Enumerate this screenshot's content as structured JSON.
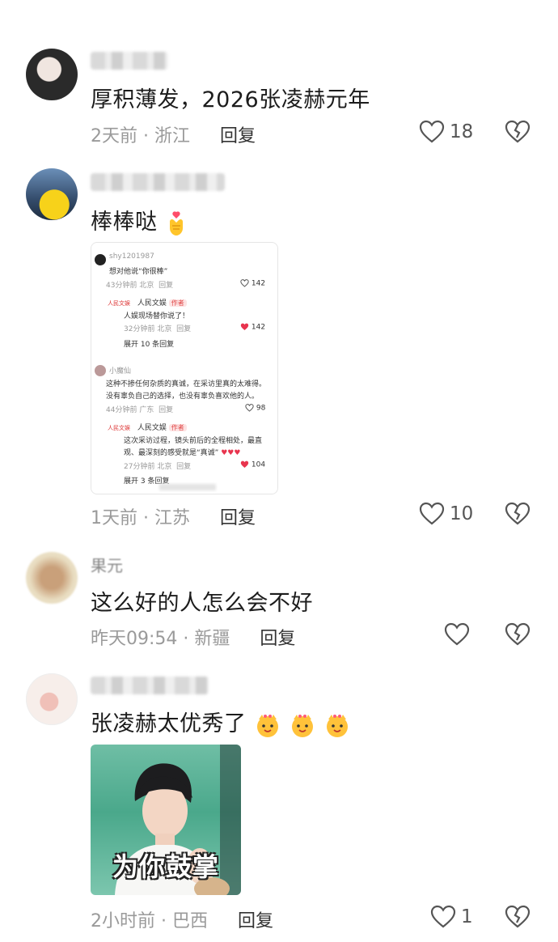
{
  "comments": [
    {
      "text": "厚积薄发，2026张凌赫元年",
      "time": "2天前",
      "location": "浙江",
      "reply_label": "回复",
      "likes": "18"
    },
    {
      "text": "棒棒哒",
      "emoji": "hand-heart",
      "time": "1天前",
      "location": "江苏",
      "reply_label": "回复",
      "likes": "10",
      "screenshot": {
        "c1_user": "shy1201987",
        "c1_text": "想对他说“你很棒”",
        "c1_meta": "43分钟前 北京",
        "c1_reply": "回复",
        "c1_likes": "142",
        "r1_user": "人民文娱",
        "r1_tag": "作者",
        "r1_text": "人娱现场替你说了！",
        "r1_meta": "32分钟前 北京",
        "r1_reply": "回复",
        "r1_likes": "142",
        "r1_expand": "展开 10 条回复",
        "c2_user": "小魔仙",
        "c2_text1": "这种不掺任何杂质的真诚，在采访里真的太难得。",
        "c2_text2": "没有辜负自己的选择，也没有辜负喜欢他的人。",
        "c2_meta": "44分钟前 广东",
        "c2_reply": "回复",
        "c2_likes": "98",
        "r2_user": "人民文娱",
        "r2_tag": "作者",
        "r2_text1": "这次采访过程，镜头前后的全程相处，最直",
        "r2_text2": "观、最深刻的感受就是“真诚”",
        "r2_meta": "27分钟前 北京",
        "r2_reply": "回复",
        "r2_likes": "104",
        "r2_expand": "展开 3 条回复"
      }
    },
    {
      "user_visible": "果元",
      "text": "这么好的人怎么会不好",
      "time": "昨天09:54",
      "location": "新疆",
      "reply_label": "回复"
    },
    {
      "text": "张凌赫太优秀了",
      "emoji": "cheering-dog",
      "time": "2小时前",
      "location": "巴西",
      "reply_label": "回复",
      "likes": "1",
      "image_caption": "为你鼓掌"
    }
  ],
  "separator": "·",
  "colors": {
    "meta_gray": "#9a9a9a",
    "like_red": "#e8344e",
    "icon_gray": "#555555"
  }
}
